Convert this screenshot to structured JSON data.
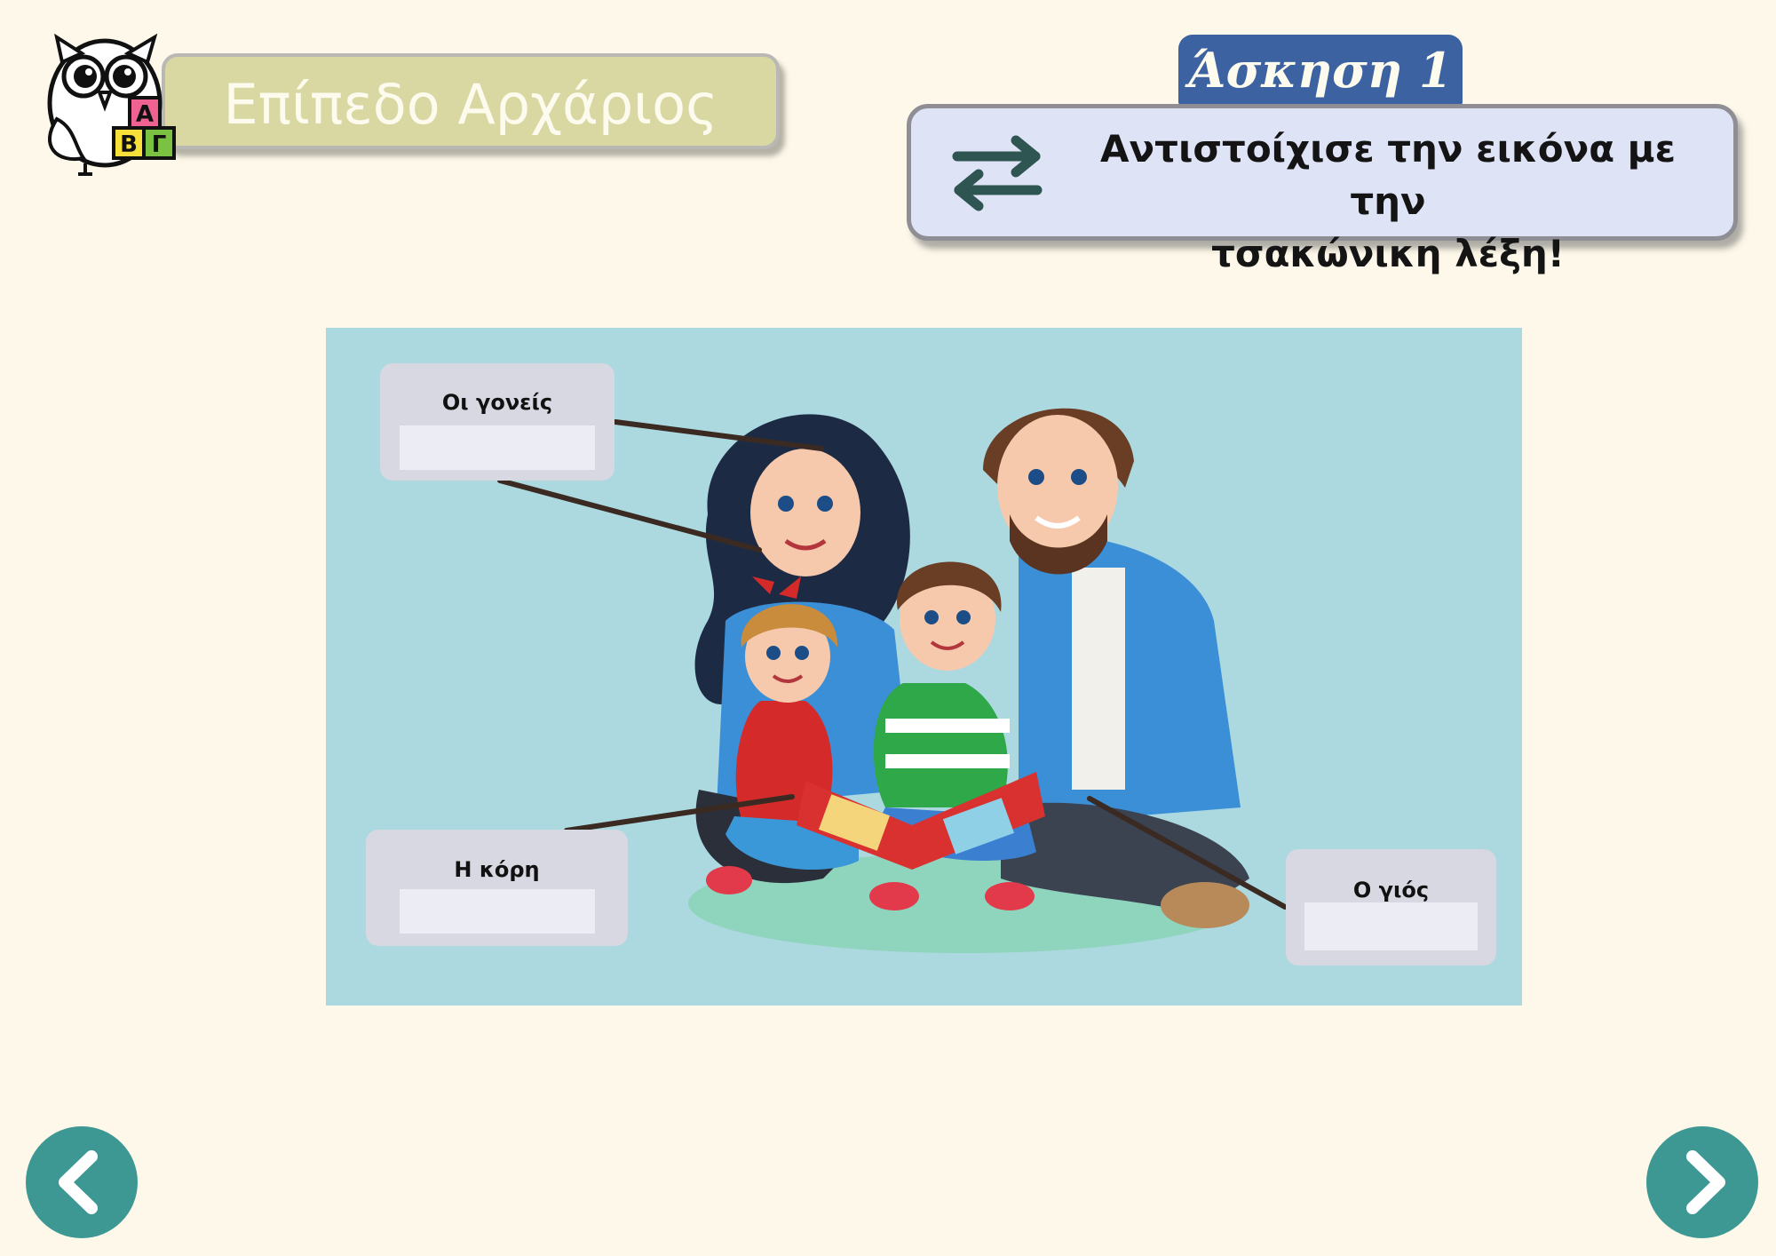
{
  "header": {
    "level_label": "Επίπεδο Αρχάριος",
    "mascot_icon": "owl-with-alphabet-blocks-icon",
    "mascot_blocks": [
      "Α",
      "Β",
      "Γ"
    ]
  },
  "exercise": {
    "tab_label": "Άσκηση 1",
    "instruction_line1": "Αντιστοίχισε την εικόνα με την",
    "instruction_line2": "τσακώνικη λέξη!",
    "instruction_icon": "swap-arrows-icon"
  },
  "picture": {
    "subject": "family-reading-book-illustration",
    "labels": [
      {
        "id": "parents",
        "text": "Οι γονείς",
        "answer": ""
      },
      {
        "id": "daughter",
        "text": "Η κόρη",
        "answer": ""
      },
      {
        "id": "son",
        "text": "Ο γιός",
        "answer": ""
      }
    ]
  },
  "navigation": {
    "prev_icon": "chevron-left-icon",
    "next_icon": "chevron-right-icon"
  },
  "colors": {
    "background": "#fdf8e9",
    "level_banner": "#d9d8a3",
    "exercise_tab": "#3c62a1",
    "instruction_card": "#dfe3f6",
    "picture_panel": "#acd8e0",
    "label_box": "#d7d8e1",
    "nav_button": "#3d9893"
  }
}
